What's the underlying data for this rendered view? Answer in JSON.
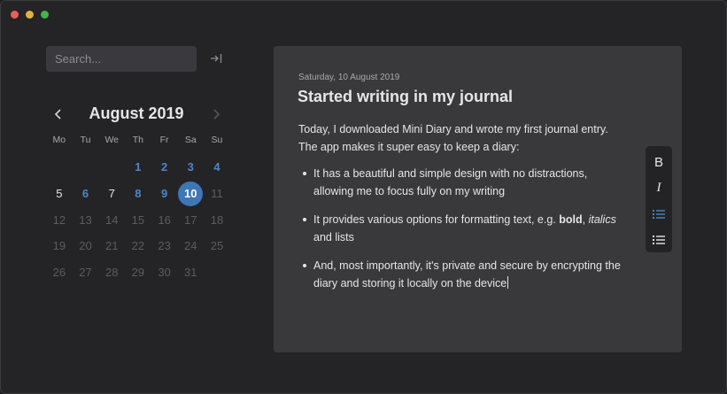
{
  "window": {
    "controls": {
      "close_color": "#ec5f56",
      "minimize_color": "#e2b23f",
      "zoom_color": "#44b34a"
    }
  },
  "sidebar": {
    "search": {
      "placeholder": "Search...",
      "value": ""
    },
    "collapse_icon": "collapse-sidebar-icon"
  },
  "calendar": {
    "month_label": "August 2019",
    "prev_icon": "chevron-left-icon",
    "next_icon": "chevron-right-icon",
    "weekdays": [
      "Mo",
      "Tu",
      "We",
      "Th",
      "Fr",
      "Sa",
      "Su"
    ],
    "days": [
      {
        "label": "",
        "state": "empty"
      },
      {
        "label": "",
        "state": "empty"
      },
      {
        "label": "",
        "state": "empty"
      },
      {
        "label": "1",
        "state": "has-entry"
      },
      {
        "label": "2",
        "state": "has-entry"
      },
      {
        "label": "3",
        "state": "has-entry"
      },
      {
        "label": "4",
        "state": "has-entry"
      },
      {
        "label": "5",
        "state": "current"
      },
      {
        "label": "6",
        "state": "has-entry"
      },
      {
        "label": "7",
        "state": "current"
      },
      {
        "label": "8",
        "state": "has-entry"
      },
      {
        "label": "9",
        "state": "has-entry"
      },
      {
        "label": "10",
        "state": "selected"
      },
      {
        "label": "11",
        "state": "future"
      },
      {
        "label": "12",
        "state": "future"
      },
      {
        "label": "13",
        "state": "future"
      },
      {
        "label": "14",
        "state": "future"
      },
      {
        "label": "15",
        "state": "future"
      },
      {
        "label": "16",
        "state": "future"
      },
      {
        "label": "17",
        "state": "future"
      },
      {
        "label": "18",
        "state": "future"
      },
      {
        "label": "19",
        "state": "future"
      },
      {
        "label": "20",
        "state": "future"
      },
      {
        "label": "21",
        "state": "future"
      },
      {
        "label": "22",
        "state": "future"
      },
      {
        "label": "23",
        "state": "future"
      },
      {
        "label": "24",
        "state": "future"
      },
      {
        "label": "25",
        "state": "future"
      },
      {
        "label": "26",
        "state": "future"
      },
      {
        "label": "27",
        "state": "future"
      },
      {
        "label": "28",
        "state": "future"
      },
      {
        "label": "29",
        "state": "future"
      },
      {
        "label": "30",
        "state": "future"
      },
      {
        "label": "31",
        "state": "future"
      }
    ],
    "colors": {
      "has_entry": "#4f86c6",
      "selected_bg": "#3f76b8",
      "future": "#5d5c61"
    }
  },
  "entry": {
    "date": "Saturday, 10 August 2019",
    "title": "Started writing in my journal",
    "intro": "Today, I downloaded Mini Diary and wrote my first journal entry. The app makes it super easy to keep a diary:",
    "bullets": {
      "first": "It has a beautiful and simple design with no distractions, allowing me to focus fully on my writing",
      "second_before": "It provides various options for formatting text, e.g. ",
      "second_bold": "bold",
      "second_sep": ", ",
      "second_italic": "italics",
      "second_after": " and lists",
      "third": "And, most importantly, it's private and secure by encrypting the diary and storing it locally on the device"
    }
  },
  "toolbar": {
    "bold_label": "B",
    "italic_label": "I",
    "bullet_list_icon": "bullet-list-icon",
    "numbered_list_icon": "numbered-list-icon",
    "active_color": "#4f86c6"
  }
}
